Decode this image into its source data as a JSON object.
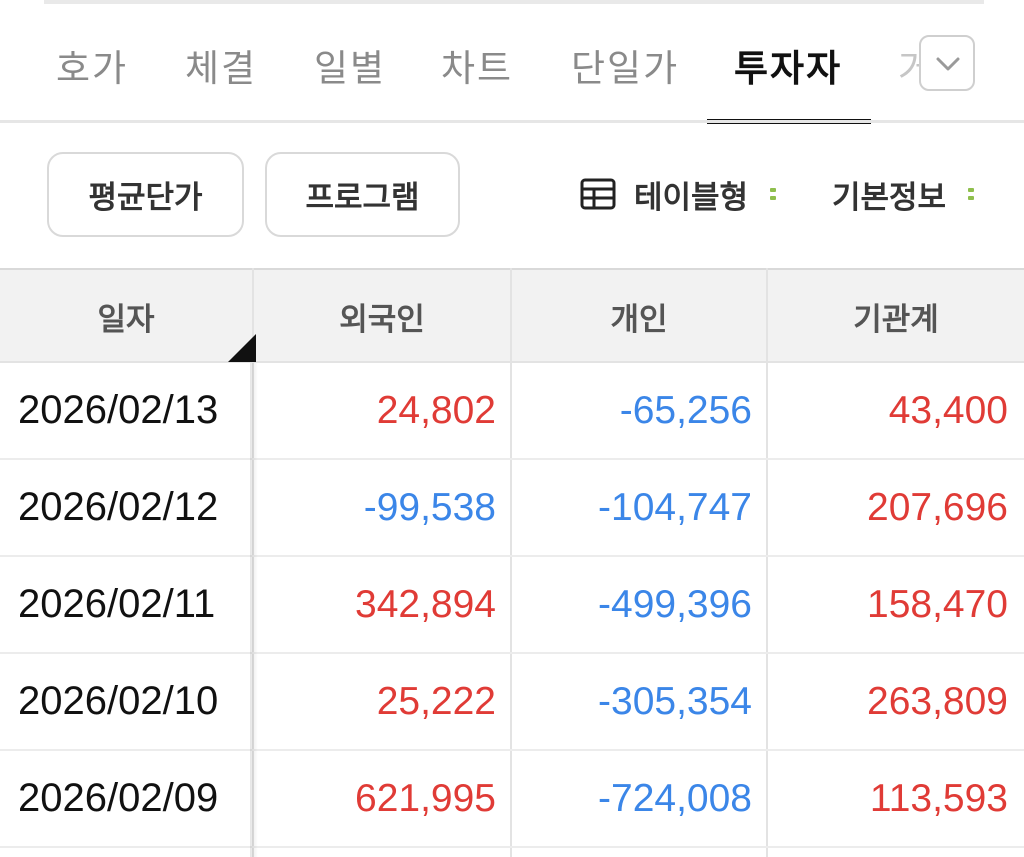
{
  "tabs": [
    {
      "label": "호가",
      "active": false
    },
    {
      "label": "체결",
      "active": false
    },
    {
      "label": "일별",
      "active": false
    },
    {
      "label": "차트",
      "active": false
    },
    {
      "label": "단일가",
      "active": false
    },
    {
      "label": "투자자",
      "active": true
    },
    {
      "label": "거",
      "active": false
    }
  ],
  "more_icon": "chevron-down-icon",
  "chips": {
    "avg_price": "평균단가",
    "program": "프로그램"
  },
  "view_options": {
    "table_view": "테이블형",
    "basic_info": "기본정보"
  },
  "table": {
    "headers": [
      "일자",
      "외국인",
      "개인",
      "기관계"
    ],
    "rows": [
      {
        "date": "2026/02/13",
        "foreign": "24,802",
        "individual": "-65,256",
        "institution": "43,400"
      },
      {
        "date": "2026/02/12",
        "foreign": "-99,538",
        "individual": "-104,747",
        "institution": "207,696"
      },
      {
        "date": "2026/02/11",
        "foreign": "342,894",
        "individual": "-499,396",
        "institution": "158,470"
      },
      {
        "date": "2026/02/10",
        "foreign": "25,222",
        "individual": "-305,354",
        "institution": "263,809"
      },
      {
        "date": "2026/02/09",
        "foreign": "621,995",
        "individual": "-724,008",
        "institution": "113,593"
      }
    ]
  },
  "colors": {
    "positive": "#e03b36",
    "negative": "#3b86e8",
    "accent_green": "#8fbf4d"
  }
}
